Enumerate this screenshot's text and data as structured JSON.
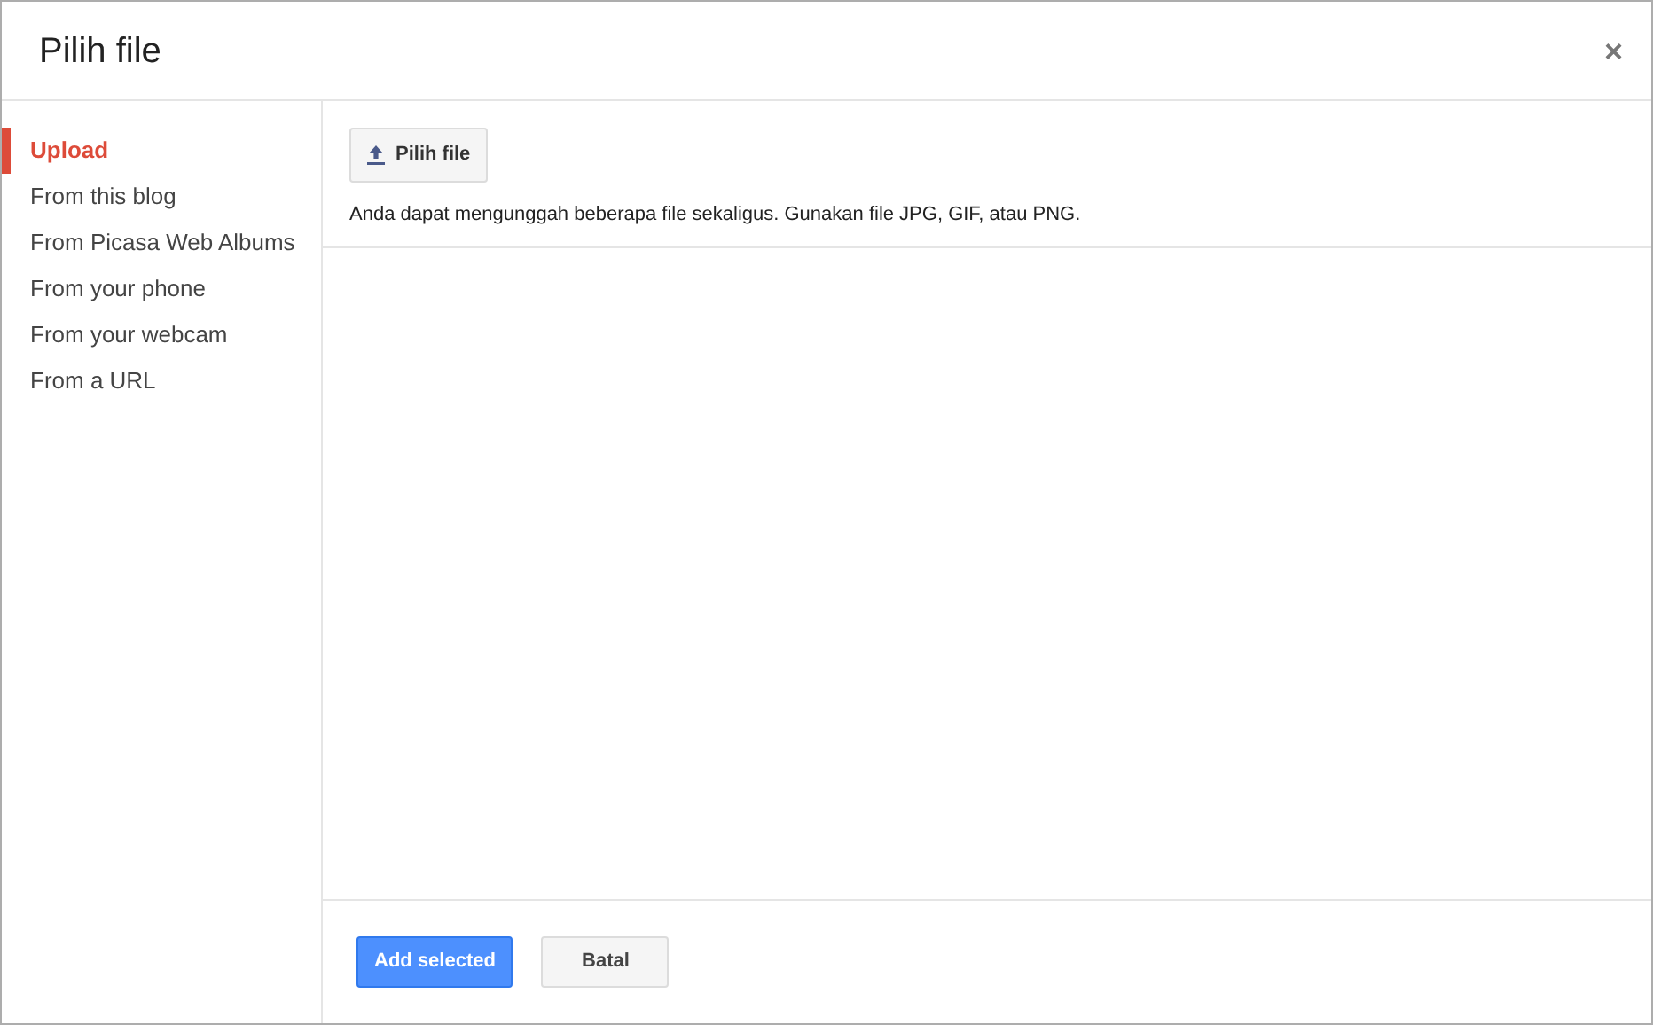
{
  "dialog": {
    "title": "Pilih file",
    "close": "×"
  },
  "sidebar": {
    "items": [
      {
        "label": "Upload",
        "selected": true
      },
      {
        "label": "From this blog",
        "selected": false
      },
      {
        "label": "From Picasa Web Albums",
        "selected": false
      },
      {
        "label": "From your phone",
        "selected": false
      },
      {
        "label": "From your webcam",
        "selected": false
      },
      {
        "label": "From a URL",
        "selected": false
      }
    ]
  },
  "upload": {
    "button": "Pilih file",
    "hint": "Anda dapat mengunggah beberapa file sekaligus. Gunakan file JPG, GIF, atau PNG."
  },
  "footer": {
    "buttons": [
      {
        "label": "Add selected",
        "kind": "primary"
      },
      {
        "label": "Batal",
        "kind": "secondary"
      }
    ]
  }
}
